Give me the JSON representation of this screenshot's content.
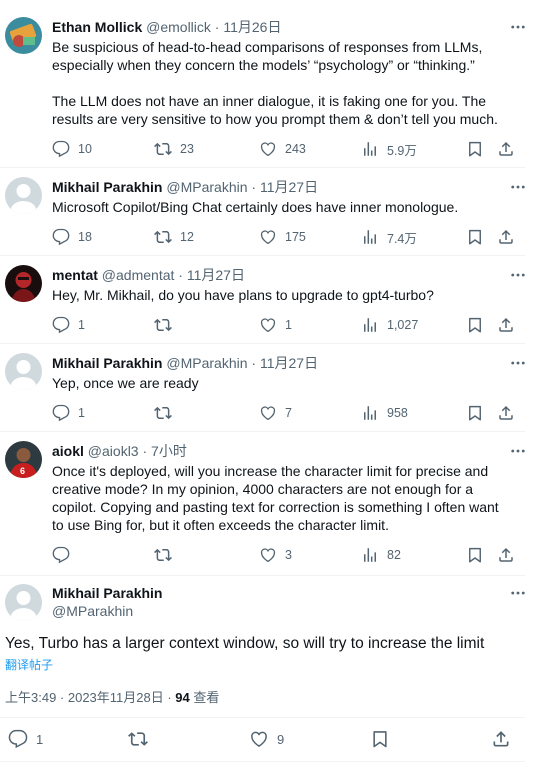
{
  "tweets": [
    {
      "name": "Ethan Mollick",
      "handle": "@emollick",
      "date": "11月26日",
      "text1": "Be suspicious of head-to-head comparisons of responses from LLMs,",
      "text2": "especially when they concern the models’ “psychology” or “thinking.”",
      "text3": "The LLM does not have an inner dialogue, it is faking one for you. The",
      "text4": "results are very sensitive to how you prompt them & don’t tell you much.",
      "replies": "10",
      "retweets": "23",
      "likes": "243",
      "views": "5.9万"
    },
    {
      "name": "Mikhail Parakhin",
      "handle": "@MParakhin",
      "date": "11月27日",
      "text1": "Microsoft Copilot/Bing Chat certainly does have inner monologue.",
      "replies": "18",
      "retweets": "12",
      "likes": "175",
      "views": "7.4万"
    },
    {
      "name": "mentat",
      "handle": "@admentat",
      "date": "11月27日",
      "text1": "Hey, Mr. Mikhail, do you have plans to upgrade to gpt4-turbo?",
      "replies": "1",
      "retweets": "",
      "likes": "1",
      "views": "1,027"
    },
    {
      "name": "Mikhail Parakhin",
      "handle": "@MParakhin",
      "date": "11月27日",
      "text1": "Yep, once we are ready",
      "replies": "1",
      "retweets": "",
      "likes": "7",
      "views": "958"
    },
    {
      "name": "aiokl",
      "handle": "@aiokl3",
      "date": "7小时",
      "text1": "Once it's deployed, will you increase the character limit for precise and",
      "text2": "creative mode? In my opinion, 4000 characters are not enough for a",
      "text3": "copilot. Copying and pasting text for correction is something I often want",
      "text4": "to use Bing for, but it often exceeds the character limit.",
      "replies": "",
      "retweets": "",
      "likes": "3",
      "views": "82"
    }
  ],
  "main": {
    "name": "Mikhail Parakhin",
    "handle": "@MParakhin",
    "text": "Yes, Turbo has a larger context window, so will try to increase the limit",
    "translate": "翻译帖子",
    "time": "上午3:49 · 2023年11月28日 · ",
    "views_count": "94",
    "views_label": " 查看",
    "replies": "1",
    "likes": "9"
  },
  "colors": {
    "text": "#0f1419",
    "secondary": "#536471",
    "link": "#1d9bf0",
    "divider": "#eff3f4"
  },
  "icons": [
    "reply-icon",
    "retweet-icon",
    "like-icon",
    "views-icon",
    "bookmark-icon",
    "share-icon",
    "more-icon"
  ]
}
